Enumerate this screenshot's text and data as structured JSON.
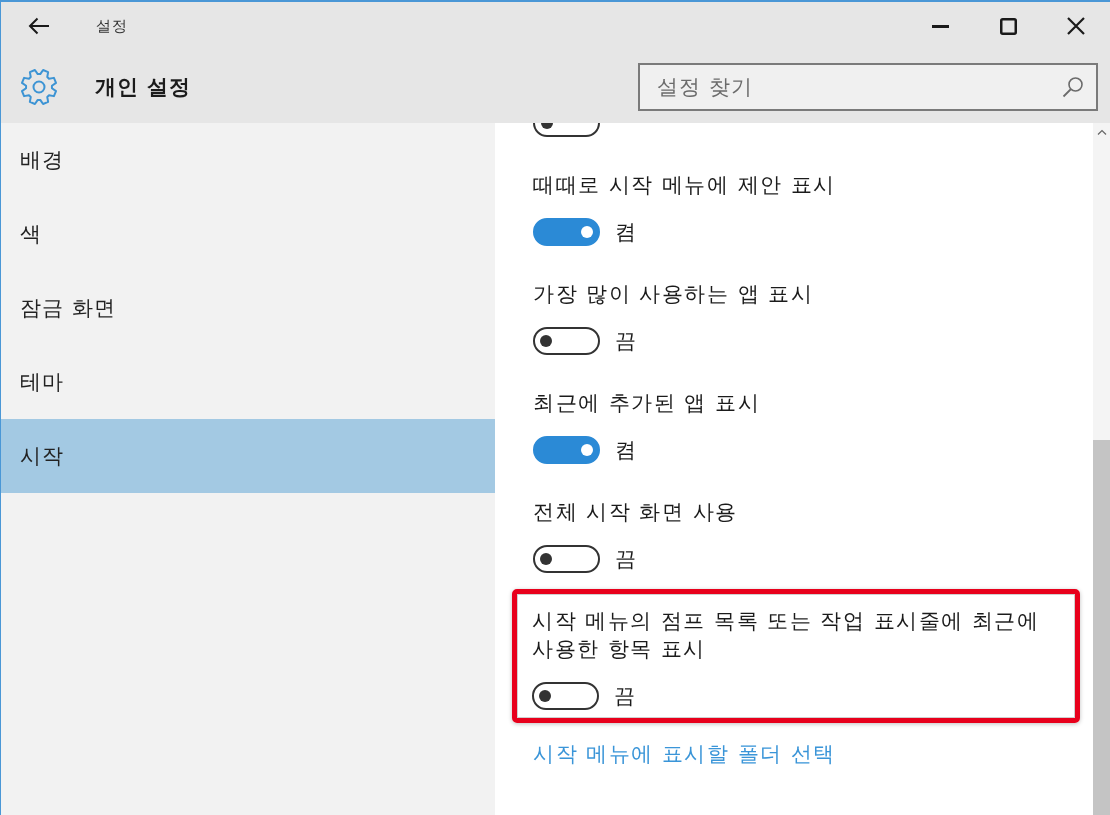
{
  "window": {
    "title": "설정"
  },
  "header": {
    "title": "개인 설정",
    "search": {
      "placeholder": "설정 찾기"
    }
  },
  "sidebar": {
    "items": [
      {
        "label": "배경",
        "selected": false
      },
      {
        "label": "색",
        "selected": false
      },
      {
        "label": "잠금 화면",
        "selected": false
      },
      {
        "label": "테마",
        "selected": false
      },
      {
        "label": "시작",
        "selected": true
      }
    ]
  },
  "settings": [
    {
      "kind": "clipped",
      "on": false
    },
    {
      "kind": "toggle",
      "label": "때때로 시작 메뉴에 제안 표시",
      "on": true,
      "state_text": "켬",
      "highlighted": false
    },
    {
      "kind": "toggle",
      "label": "가장 많이 사용하는 앱 표시",
      "on": false,
      "state_text": "끔",
      "highlighted": false
    },
    {
      "kind": "toggle",
      "label": "최근에 추가된 앱 표시",
      "on": true,
      "state_text": "켬",
      "highlighted": false
    },
    {
      "kind": "toggle",
      "label": "전체 시작 화면 사용",
      "on": false,
      "state_text": "끔",
      "highlighted": false
    },
    {
      "kind": "toggle",
      "label": "시작 메뉴의 점프 목록 또는 작업 표시줄에 최근에 사용한 항목 표시",
      "on": false,
      "state_text": "끔",
      "highlighted": true
    }
  ],
  "link": {
    "label": "시작 메뉴에 표시할 폴더 선택"
  }
}
